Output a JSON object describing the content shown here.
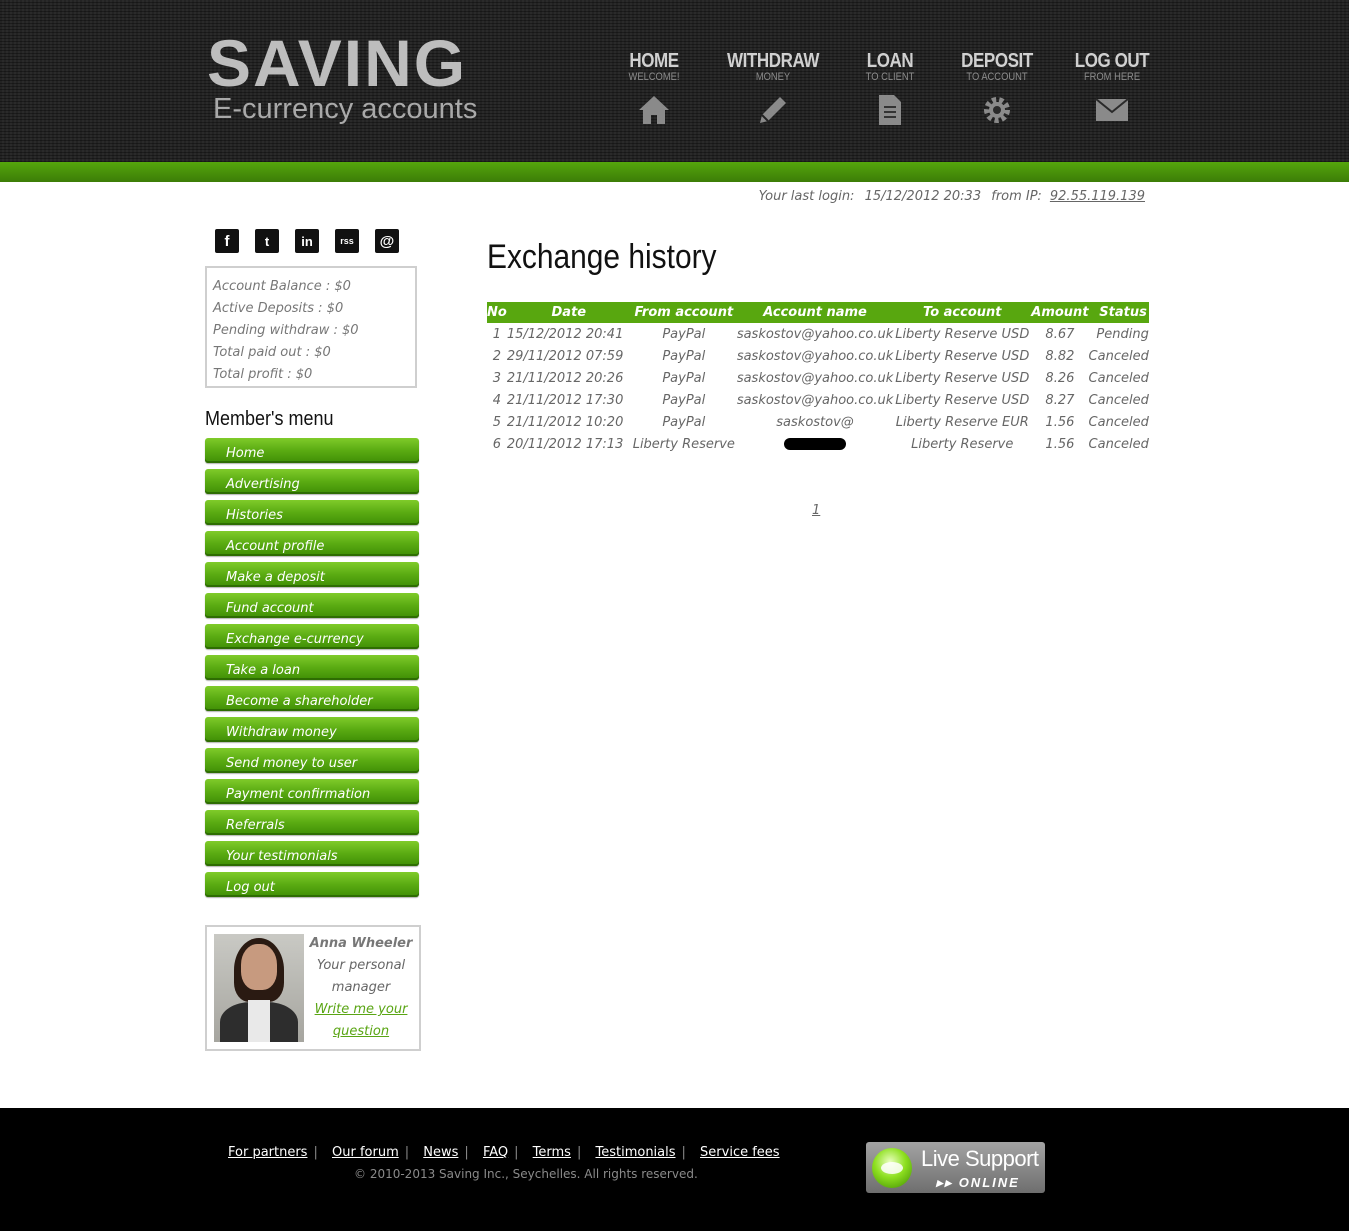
{
  "logo": {
    "title": "SAVING",
    "subtitle": "E-currency accounts"
  },
  "topnav": [
    {
      "label": "HOME",
      "sub": "WELCOME!",
      "icon": "house-icon"
    },
    {
      "label": "WITHDRAW",
      "sub": "MONEY",
      "icon": "pencil-icon"
    },
    {
      "label": "LOAN",
      "sub": "TO CLIENT",
      "icon": "document-icon"
    },
    {
      "label": "DEPOSIT",
      "sub": "TO ACCOUNT",
      "icon": "gear-icon"
    },
    {
      "label": "LOG OUT",
      "sub": "FROM HERE",
      "icon": "envelope-icon"
    }
  ],
  "last_login": {
    "label": "Your last login:",
    "datetime": "15/12/2012 20:33",
    "ip_label": "from IP:",
    "ip": "92.55.119.139"
  },
  "social": [
    {
      "glyph": "f",
      "icon": "facebook-icon"
    },
    {
      "glyph": "t",
      "icon": "twitter-icon"
    },
    {
      "glyph": "in",
      "icon": "linkedin-icon"
    },
    {
      "glyph": "rss",
      "icon": "rss-icon"
    },
    {
      "glyph": "@",
      "icon": "email-icon"
    }
  ],
  "account": {
    "balance": "Account Balance  : $0",
    "active_deposits": "Active Deposits  : $0",
    "pending_withdraw": "Pending withdraw  : $0",
    "total_paid_out": "Total paid out  : $0",
    "total_profit": "Total profit  : $0"
  },
  "member_menu": {
    "title": "Member's menu",
    "items": [
      "Home",
      "Advertising",
      "Histories",
      "Account profile",
      "Make a deposit",
      "Fund account",
      "Exchange e-currency",
      "Take a loan",
      "Become a shareholder",
      "Withdraw money",
      "Send money to user",
      "Payment confirmation",
      "Referrals",
      "Your testimonials",
      "Log out"
    ]
  },
  "manager": {
    "name": "Anna Wheeler",
    "role_line1": "Your personal",
    "role_line2": "manager",
    "link_line1": "Write me your",
    "link_line2": "question"
  },
  "page_title": "Exchange history",
  "table": {
    "headers": [
      "No",
      "Date",
      "From account",
      "Account name",
      "To account",
      "Amount",
      "Status"
    ],
    "rows": [
      [
        "1",
        "15/12/2012 20:41",
        "PayPal",
        "saskostov@yahoo.co.uk",
        "Liberty Reserve USD",
        "8.67",
        "Pending"
      ],
      [
        "2",
        "29/11/2012 07:59",
        "PayPal",
        "saskostov@yahoo.co.uk",
        "Liberty Reserve USD",
        "8.82",
        "Canceled"
      ],
      [
        "3",
        "21/11/2012 20:26",
        "PayPal",
        "saskostov@yahoo.co.uk",
        "Liberty Reserve USD",
        "8.26",
        "Canceled"
      ],
      [
        "4",
        "21/11/2012 17:30",
        "PayPal",
        "saskostov@yahoo.co.uk",
        "Liberty Reserve USD",
        "8.27",
        "Canceled"
      ],
      [
        "5",
        "21/11/2012 10:20",
        "PayPal",
        "saskostov@",
        "Liberty Reserve EUR",
        "1.56",
        "Canceled"
      ],
      [
        "6",
        "20/11/2012 17:13",
        "Liberty Reserve",
        "",
        "Liberty Reserve",
        "1.56",
        "Canceled"
      ]
    ]
  },
  "pager": {
    "current": "1"
  },
  "footer": {
    "links": [
      "For partners",
      "Our forum",
      "News",
      "FAQ",
      "Terms",
      "Testimonials",
      "Service fees"
    ],
    "separator": "|",
    "copyright": "© 2010-2013 Saving Inc., Seychelles. All rights reserved."
  },
  "live_support": {
    "title": "Live Support",
    "status": "ONLINE",
    "status_prefix": "▸▸"
  },
  "colors": {
    "accent": "#58a70f",
    "header_bg": "#222222",
    "footer_bg": "#000000"
  }
}
